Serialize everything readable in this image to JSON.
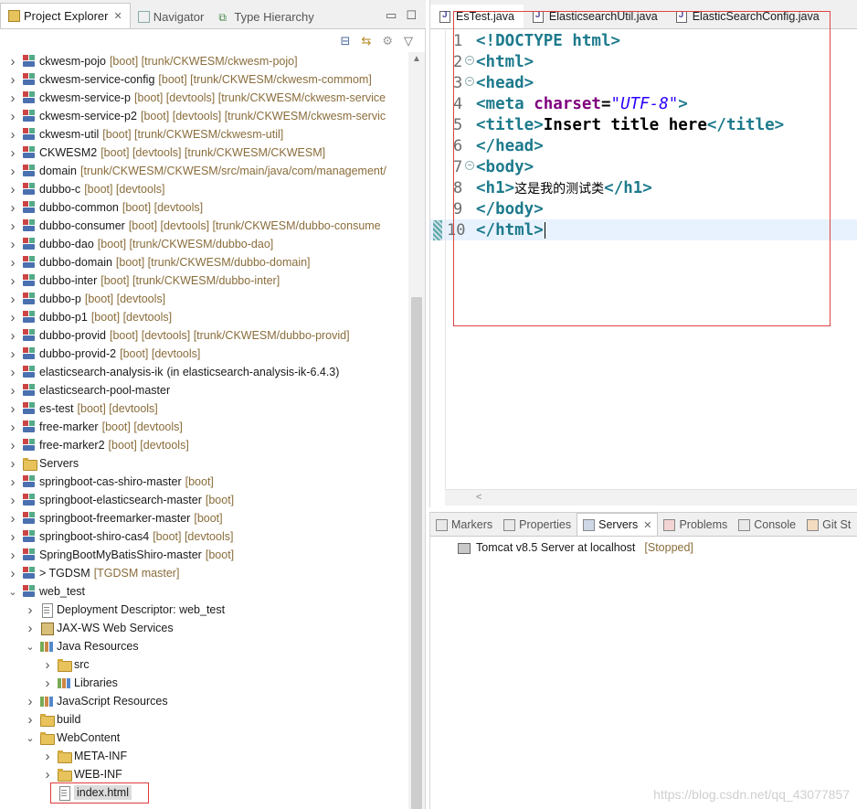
{
  "explorer": {
    "tabs": [
      {
        "label": "Project Explorer",
        "active": true
      },
      {
        "label": "Navigator",
        "active": false
      },
      {
        "label": "Type Hierarchy",
        "active": false
      }
    ],
    "rows": [
      {
        "name": "ckwesm-pojo",
        "dec": "[boot] [trunk/CKWESM/ckwesm-pojo]",
        "icon": "project",
        "depth": 0,
        "exp": ">"
      },
      {
        "name": "ckwesm-service-config",
        "dec": "[boot] [trunk/CKWESM/ckwesm-commom]",
        "icon": "project",
        "depth": 0,
        "exp": ">"
      },
      {
        "name": "ckwesm-service-p",
        "dec": "[boot] [devtools] [trunk/CKWESM/ckwesm-service",
        "icon": "project",
        "depth": 0,
        "exp": ">"
      },
      {
        "name": "ckwesm-service-p2",
        "dec": "[boot] [devtools] [trunk/CKWESM/ckwesm-servic",
        "icon": "project",
        "depth": 0,
        "exp": ">"
      },
      {
        "name": "ckwesm-util",
        "dec": "[boot] [trunk/CKWESM/ckwesm-util]",
        "icon": "project",
        "depth": 0,
        "exp": ">"
      },
      {
        "name": "CKWESM2",
        "dec": "[boot] [devtools] [trunk/CKWESM/CKWESM]",
        "icon": "project",
        "depth": 0,
        "exp": ">"
      },
      {
        "name": "domain",
        "dec": "[trunk/CKWESM/CKWESM/src/main/java/com/management/",
        "icon": "project",
        "depth": 0,
        "exp": ">"
      },
      {
        "name": "dubbo-c",
        "dec": "[boot] [devtools]",
        "icon": "project",
        "depth": 0,
        "exp": ">"
      },
      {
        "name": "dubbo-common",
        "dec": "[boot] [devtools]",
        "icon": "project",
        "depth": 0,
        "exp": ">"
      },
      {
        "name": "dubbo-consumer",
        "dec": "[boot] [devtools] [trunk/CKWESM/dubbo-consume",
        "icon": "project",
        "depth": 0,
        "exp": ">"
      },
      {
        "name": "dubbo-dao",
        "dec": "[boot] [trunk/CKWESM/dubbo-dao]",
        "icon": "project",
        "depth": 0,
        "exp": ">"
      },
      {
        "name": "dubbo-domain",
        "dec": "[boot] [trunk/CKWESM/dubbo-domain]",
        "icon": "project",
        "depth": 0,
        "exp": ">"
      },
      {
        "name": "dubbo-inter",
        "dec": "[boot] [trunk/CKWESM/dubbo-inter]",
        "icon": "project",
        "depth": 0,
        "exp": ">"
      },
      {
        "name": "dubbo-p",
        "dec": "[boot] [devtools]",
        "icon": "project",
        "depth": 0,
        "exp": ">"
      },
      {
        "name": "dubbo-p1",
        "dec": "[boot] [devtools]",
        "icon": "project",
        "depth": 0,
        "exp": ">"
      },
      {
        "name": "dubbo-provid",
        "dec": "[boot] [devtools] [trunk/CKWESM/dubbo-provid]",
        "icon": "project",
        "depth": 0,
        "exp": ">"
      },
      {
        "name": "dubbo-provid-2",
        "dec": "[boot] [devtools]",
        "icon": "project",
        "depth": 0,
        "exp": ">"
      },
      {
        "name": "elasticsearch-analysis-ik",
        "dec": "(in elasticsearch-analysis-ik-6.4.3)",
        "icon": "project",
        "depth": 0,
        "exp": ">",
        "decPlain": true
      },
      {
        "name": "elasticsearch-pool-master",
        "dec": "",
        "icon": "project",
        "depth": 0,
        "exp": ">"
      },
      {
        "name": "es-test",
        "dec": "[boot] [devtools]",
        "icon": "project",
        "depth": 0,
        "exp": ">"
      },
      {
        "name": "free-marker",
        "dec": "[boot] [devtools]",
        "icon": "project",
        "depth": 0,
        "exp": ">"
      },
      {
        "name": "free-marker2",
        "dec": "[boot] [devtools]",
        "icon": "project",
        "depth": 0,
        "exp": ">"
      },
      {
        "name": "Servers",
        "dec": "",
        "icon": "folder",
        "depth": 0,
        "exp": ">"
      },
      {
        "name": "springboot-cas-shiro-master",
        "dec": "[boot]",
        "icon": "project",
        "depth": 0,
        "exp": ">"
      },
      {
        "name": "springboot-elasticsearch-master",
        "dec": "[boot]",
        "icon": "project",
        "depth": 0,
        "exp": ">"
      },
      {
        "name": "springboot-freemarker-master",
        "dec": "[boot]",
        "icon": "project",
        "depth": 0,
        "exp": ">"
      },
      {
        "name": "springboot-shiro-cas4",
        "dec": "[boot] [devtools]",
        "icon": "project",
        "depth": 0,
        "exp": ">"
      },
      {
        "name": "SpringBootMyBatisShiro-master",
        "dec": "[boot]",
        "icon": "project",
        "depth": 0,
        "exp": ">"
      },
      {
        "name": "> TGDSM",
        "dec": "[TGDSM master]",
        "icon": "project",
        "depth": 0,
        "exp": ">"
      },
      {
        "name": "web_test",
        "dec": "",
        "icon": "project",
        "depth": 0,
        "exp": "v"
      },
      {
        "name": "Deployment Descriptor: web_test",
        "dec": "",
        "icon": "file",
        "depth": 1,
        "exp": ">"
      },
      {
        "name": "JAX-WS Web Services",
        "dec": "",
        "icon": "server",
        "depth": 1,
        "exp": ">"
      },
      {
        "name": "Java Resources",
        "dec": "",
        "icon": "lib",
        "depth": 1,
        "exp": "v"
      },
      {
        "name": "src",
        "dec": "",
        "icon": "folder",
        "depth": 2,
        "exp": ">"
      },
      {
        "name": "Libraries",
        "dec": "",
        "icon": "lib",
        "depth": 2,
        "exp": ">"
      },
      {
        "name": "JavaScript Resources",
        "dec": "",
        "icon": "lib",
        "depth": 1,
        "exp": ">"
      },
      {
        "name": "build",
        "dec": "",
        "icon": "folder",
        "depth": 1,
        "exp": ">"
      },
      {
        "name": "WebContent",
        "dec": "",
        "icon": "folder",
        "depth": 1,
        "exp": "v"
      },
      {
        "name": "META-INF",
        "dec": "",
        "icon": "folder",
        "depth": 2,
        "exp": ">"
      },
      {
        "name": "WEB-INF",
        "dec": "",
        "icon": "folder",
        "depth": 2,
        "exp": ">"
      },
      {
        "name": "index.html",
        "dec": "",
        "icon": "file",
        "depth": 2,
        "exp": "",
        "selected": true
      }
    ]
  },
  "editor": {
    "tabs": [
      {
        "label": "EsTest.java"
      },
      {
        "label": "ElasticsearchUtil.java"
      },
      {
        "label": "ElasticSearchConfig.java"
      }
    ],
    "lines": [
      {
        "n": "1",
        "fold": false,
        "segs": [
          [
            "tag",
            "<!DOCTYPE html>"
          ]
        ]
      },
      {
        "n": "2",
        "fold": true,
        "segs": [
          [
            "tag",
            "<html>"
          ]
        ]
      },
      {
        "n": "3",
        "fold": true,
        "segs": [
          [
            "tag",
            "<head>"
          ]
        ]
      },
      {
        "n": "4",
        "fold": false,
        "segs": [
          [
            "tag",
            "<meta "
          ],
          [
            "attr",
            "charset"
          ],
          [
            "tagtext",
            "="
          ],
          [
            "aval",
            "\"UTF-8\""
          ],
          [
            "tag",
            ">"
          ]
        ]
      },
      {
        "n": "5",
        "fold": false,
        "segs": [
          [
            "tag",
            "<title>"
          ],
          [
            "tagtext",
            "Insert title here"
          ],
          [
            "tag",
            "</title>"
          ]
        ]
      },
      {
        "n": "6",
        "fold": false,
        "segs": [
          [
            "tag",
            "</head>"
          ]
        ]
      },
      {
        "n": "7",
        "fold": true,
        "segs": [
          [
            "tag",
            "<body>"
          ]
        ]
      },
      {
        "n": "8",
        "fold": false,
        "segs": [
          [
            "tag",
            "<h1>"
          ],
          [
            "cjk",
            "这是我的测试类"
          ],
          [
            "tag",
            "</h1>"
          ]
        ]
      },
      {
        "n": "9",
        "fold": false,
        "segs": [
          [
            "tag",
            "</body>"
          ]
        ]
      },
      {
        "n": "10",
        "fold": false,
        "segs": [
          [
            "tag",
            "</html>"
          ]
        ],
        "current": true
      }
    ]
  },
  "servers_panel": {
    "tabs": [
      {
        "label": "Markers",
        "active": false
      },
      {
        "label": "Properties",
        "active": false
      },
      {
        "label": "Servers",
        "active": true
      },
      {
        "label": "Problems",
        "active": false
      },
      {
        "label": "Console",
        "active": false
      },
      {
        "label": "Git St",
        "active": false
      }
    ],
    "server_name": "Tomcat v8.5 Server at localhost",
    "server_status": "[Stopped]"
  },
  "watermark": "https://blog.csdn.net/qq_43077857"
}
